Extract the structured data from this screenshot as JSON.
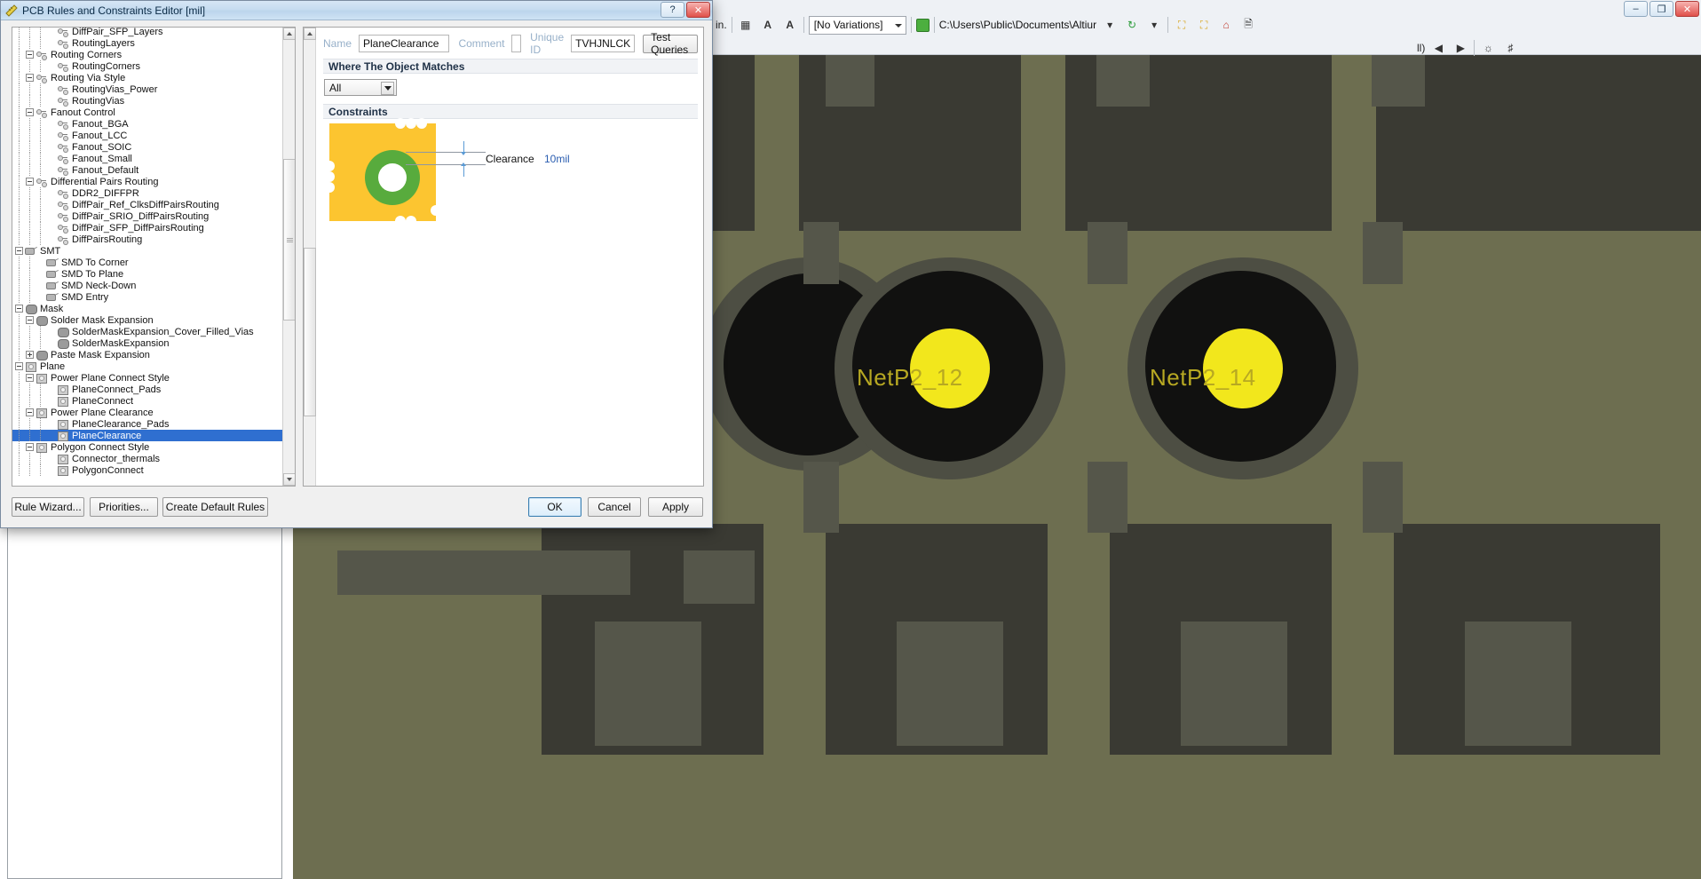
{
  "dialog": {
    "title": "PCB Rules and Constraints Editor [mil]",
    "icon": "ruler-icon",
    "window_buttons": [
      {
        "name": "help-button",
        "glyph": "?"
      },
      {
        "name": "close-button",
        "glyph": "✕"
      }
    ],
    "tree": {
      "name": "rules-tree",
      "selected": "PlaneClearance",
      "items": [
        {
          "label": "DiffPair_SFP_Layers",
          "depth": 4,
          "icon": "routing-rule-icon",
          "expander": "none"
        },
        {
          "label": "RoutingLayers",
          "depth": 4,
          "icon": "routing-rule-icon",
          "expander": "none"
        },
        {
          "label": "Routing Corners",
          "depth": 2,
          "icon": "routing-rule-icon",
          "expander": "minus"
        },
        {
          "label": "RoutingCorners",
          "depth": 4,
          "icon": "routing-rule-icon",
          "expander": "none"
        },
        {
          "label": "Routing Via Style",
          "depth": 2,
          "icon": "routing-rule-icon",
          "expander": "minus"
        },
        {
          "label": "RoutingVias_Power",
          "depth": 4,
          "icon": "routing-rule-icon",
          "expander": "none"
        },
        {
          "label": "RoutingVias",
          "depth": 4,
          "icon": "routing-rule-icon",
          "expander": "none"
        },
        {
          "label": "Fanout Control",
          "depth": 2,
          "icon": "routing-rule-icon",
          "expander": "minus"
        },
        {
          "label": "Fanout_BGA",
          "depth": 4,
          "icon": "routing-rule-icon",
          "expander": "none"
        },
        {
          "label": "Fanout_LCC",
          "depth": 4,
          "icon": "routing-rule-icon",
          "expander": "none"
        },
        {
          "label": "Fanout_SOIC",
          "depth": 4,
          "icon": "routing-rule-icon",
          "expander": "none"
        },
        {
          "label": "Fanout_Small",
          "depth": 4,
          "icon": "routing-rule-icon",
          "expander": "none"
        },
        {
          "label": "Fanout_Default",
          "depth": 4,
          "icon": "routing-rule-icon",
          "expander": "none"
        },
        {
          "label": "Differential Pairs Routing",
          "depth": 2,
          "icon": "routing-rule-icon",
          "expander": "minus"
        },
        {
          "label": "DDR2_DIFFPR",
          "depth": 4,
          "icon": "routing-rule-icon",
          "expander": "none"
        },
        {
          "label": "DiffPair_Ref_ClksDiffPairsRouting",
          "depth": 4,
          "icon": "routing-rule-icon",
          "expander": "none"
        },
        {
          "label": "DiffPair_SRIO_DiffPairsRouting",
          "depth": 4,
          "icon": "routing-rule-icon",
          "expander": "none"
        },
        {
          "label": "DiffPair_SFP_DiffPairsRouting",
          "depth": 4,
          "icon": "routing-rule-icon",
          "expander": "none"
        },
        {
          "label": "DiffPairsRouting",
          "depth": 4,
          "icon": "routing-rule-icon",
          "expander": "none"
        },
        {
          "label": "SMT",
          "depth": 1,
          "icon": "smt-rule-icon",
          "expander": "minus"
        },
        {
          "label": "SMD To Corner",
          "depth": 3,
          "icon": "smt-rule-icon",
          "expander": "none"
        },
        {
          "label": "SMD To Plane",
          "depth": 3,
          "icon": "smt-rule-icon",
          "expander": "none"
        },
        {
          "label": "SMD Neck-Down",
          "depth": 3,
          "icon": "smt-rule-icon",
          "expander": "none"
        },
        {
          "label": "SMD Entry",
          "depth": 3,
          "icon": "smt-rule-icon",
          "expander": "none"
        },
        {
          "label": "Mask",
          "depth": 1,
          "icon": "mask-rule-icon",
          "expander": "minus"
        },
        {
          "label": "Solder Mask Expansion",
          "depth": 2,
          "icon": "mask-rule-icon",
          "expander": "minus"
        },
        {
          "label": "SolderMaskExpansion_Cover_Filled_Vias",
          "depth": 4,
          "icon": "mask-rule-icon",
          "expander": "none"
        },
        {
          "label": "SolderMaskExpansion",
          "depth": 4,
          "icon": "mask-rule-icon",
          "expander": "none"
        },
        {
          "label": "Paste Mask Expansion",
          "depth": 2,
          "icon": "mask-rule-icon",
          "expander": "plus"
        },
        {
          "label": "Plane",
          "depth": 1,
          "icon": "plane-rule-icon",
          "expander": "minus"
        },
        {
          "label": "Power Plane Connect Style",
          "depth": 2,
          "icon": "plane-rule-icon",
          "expander": "minus"
        },
        {
          "label": "PlaneConnect_Pads",
          "depth": 4,
          "icon": "plane-rule-icon",
          "expander": "none"
        },
        {
          "label": "PlaneConnect",
          "depth": 4,
          "icon": "plane-rule-icon",
          "expander": "none"
        },
        {
          "label": "Power Plane Clearance",
          "depth": 2,
          "icon": "plane-rule-icon",
          "expander": "minus"
        },
        {
          "label": "PlaneClearance_Pads",
          "depth": 4,
          "icon": "plane-rule-icon",
          "expander": "none"
        },
        {
          "label": "PlaneClearance",
          "depth": 4,
          "icon": "plane-rule-icon",
          "expander": "none",
          "selected": true
        },
        {
          "label": "Polygon Connect Style",
          "depth": 2,
          "icon": "plane-rule-icon",
          "expander": "minus"
        },
        {
          "label": "Connector_thermals",
          "depth": 4,
          "icon": "plane-rule-icon",
          "expander": "none"
        },
        {
          "label": "PolygonConnect",
          "depth": 4,
          "icon": "plane-rule-icon",
          "expander": "none"
        }
      ]
    },
    "rule": {
      "name_label": "Name",
      "name_value": "PlaneClearance",
      "comment_label": "Comment",
      "comment_value": "",
      "unique_id_label": "Unique ID",
      "unique_id_value": "TVHJNLCK",
      "test_queries_label": "Test Queries",
      "where_header": "Where The Object Matches",
      "scope_value": "All",
      "scope_options": [
        "All"
      ],
      "constraints_header": "Constraints",
      "clearance_label": "Clearance",
      "clearance_value": "10mil"
    },
    "footer": {
      "rule_wizard": "Rule Wizard...",
      "priorities": "Priorities...",
      "create_default_rules": "Create Default Rules",
      "ok": "OK",
      "cancel": "Cancel",
      "apply": "Apply"
    }
  },
  "toolbar": {
    "units_text": "in.",
    "variations": "[No Variations]",
    "path": "C:\\Users\\Public\\Documents\\Altiur",
    "all_text": "ll)",
    "icons": [
      "board-icon",
      "text-a-icon",
      "text-a2-icon",
      "green-check-icon",
      "refresh-icon",
      "dropdown-icon",
      "window-icon",
      "home-icon",
      "page-icon",
      "left-arrow-icon",
      "right-arrow-icon",
      "filter-icon",
      "clear-filter-icon"
    ],
    "window_buttons": [
      {
        "name": "minimize-button",
        "glyph": "–"
      },
      {
        "name": "maximize-button",
        "glyph": "❐"
      },
      {
        "name": "close-button",
        "glyph": "✕"
      }
    ]
  },
  "pcb": {
    "net_labels": [
      "NetP2_12",
      "NetP2_14"
    ],
    "colors": {
      "background": "#6d6e50",
      "copper_dark": "#3a3a33",
      "pad_gray": "#55564a",
      "via_yellow": "#f2e71c",
      "net_text": "#b7a822"
    }
  }
}
